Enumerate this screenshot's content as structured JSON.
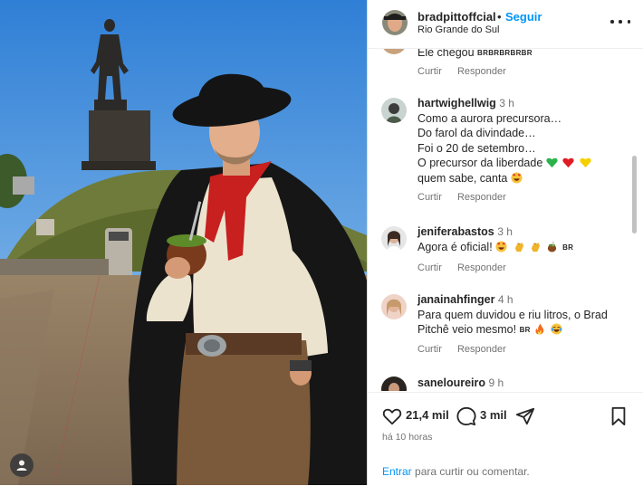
{
  "post": {
    "username": "bradpittoffcial",
    "separator": "•",
    "follow_label": "Seguir",
    "location": "Rio Grande do Sul"
  },
  "comments": [
    {
      "username": "",
      "time": "",
      "text": "Ele chegou",
      "suffix": "BRBRBRBRBR",
      "emojis": [],
      "reply": "Responder",
      "like": "Curtir"
    },
    {
      "username": "hartwighellwig",
      "time": "3 h",
      "lines": [
        "Como a aurora precursora…",
        "Do farol da divindade…",
        "Foi o 20 de setembro…",
        "O precursor da liberdade",
        "quem sabe, canta"
      ],
      "line4_emojis": [
        "green-heart",
        "red-heart",
        "yellow-heart"
      ],
      "line5_emojis": [
        "heart-eyes"
      ],
      "like": "Curtir",
      "reply": "Responder"
    },
    {
      "username": "jeniferabastos",
      "time": "3 h",
      "text": "Agora é oficial!",
      "suffix": "BR",
      "emojis": [
        "heart-eyes",
        "clap",
        "clap",
        "mate"
      ],
      "like": "Curtir",
      "reply": "Responder"
    },
    {
      "username": "janainahfinger",
      "time": "4 h",
      "lines": [
        "Para quem duvidou e riu litros, o Brad",
        "Pitchê veio mesmo!"
      ],
      "suffix": "BR",
      "emojis": [
        "fire",
        "joy"
      ],
      "like": "Curtir",
      "reply": "Responder"
    },
    {
      "username": "saneloureiro",
      "time": "9 h"
    }
  ],
  "footer": {
    "likes": "21,4 mil",
    "comments": "3 mil",
    "time_ago": "há 10 horas",
    "login_link": "Entrar",
    "login_rest": "para curtir ou comentar."
  },
  "icons": [
    "heart-icon",
    "comment-icon",
    "share-icon",
    "bookmark-icon",
    "more-options-icon",
    "user-tag-icon"
  ],
  "colors": {
    "accent": "#0095f6",
    "text": "#262626",
    "muted": "#737373"
  }
}
